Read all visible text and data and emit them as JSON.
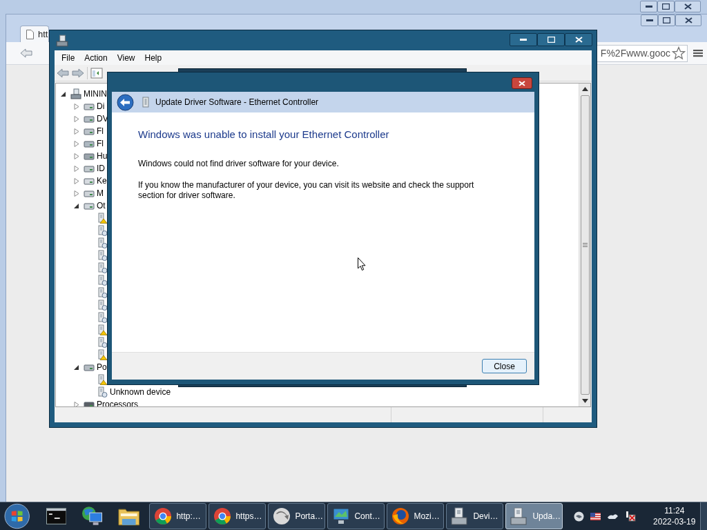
{
  "browser": {
    "tab_title": "htt",
    "address": "F%2Fwww.gooc"
  },
  "device_manager": {
    "menu": [
      "File",
      "Action",
      "View",
      "Help"
    ],
    "tree": [
      {
        "label": "MININ",
        "expanded": true,
        "children": [
          {
            "label": "Di",
            "expanded": false
          },
          {
            "label": "DV",
            "expanded": false
          },
          {
            "label": "Fl",
            "expanded": false
          },
          {
            "label": "Fl",
            "expanded": false
          },
          {
            "label": "Hu",
            "expanded": false
          },
          {
            "label": "ID",
            "expanded": false
          },
          {
            "label": "Ke",
            "expanded": false
          },
          {
            "label": "M",
            "expanded": false
          },
          {
            "label": "Ot",
            "expanded": true,
            "children": [
              {
                "warning": true
              },
              {
                "warning": false
              },
              {
                "warning": false
              },
              {
                "warning": false
              },
              {
                "warning": false
              },
              {
                "warning": false
              },
              {
                "warning": false
              },
              {
                "warning": false
              },
              {
                "warning": false
              },
              {
                "warning": true
              },
              {
                "warning": false
              },
              {
                "warning": true
              }
            ]
          },
          {
            "label": "Po",
            "expanded": true,
            "children": [
              {
                "warning": true
              },
              {
                "label": "Unknown device",
                "warning": false
              }
            ]
          },
          {
            "label": "Processors",
            "expanded": false
          }
        ]
      }
    ]
  },
  "dialog": {
    "title": "Update Driver Software - Ethernet Controller",
    "heading": "Windows was unable to install your Ethernet Controller",
    "paragraphs": [
      "Windows could not find driver software for your device.",
      "If you know the manufacturer of your device, you can visit its website and check the support section for driver software."
    ],
    "button": "Close"
  },
  "taskbar": {
    "windows": [
      {
        "label": "http:…",
        "selected": false
      },
      {
        "label": "https…",
        "selected": false
      },
      {
        "label": "Porta…",
        "selected": false
      },
      {
        "label": "Cont…",
        "selected": false
      },
      {
        "label": "Mozi…",
        "selected": false
      },
      {
        "label": "Devi…",
        "selected": false
      },
      {
        "label": "Upda…",
        "selected": true
      }
    ],
    "clock": {
      "time": "11:24",
      "date": "2022-03-19"
    }
  }
}
